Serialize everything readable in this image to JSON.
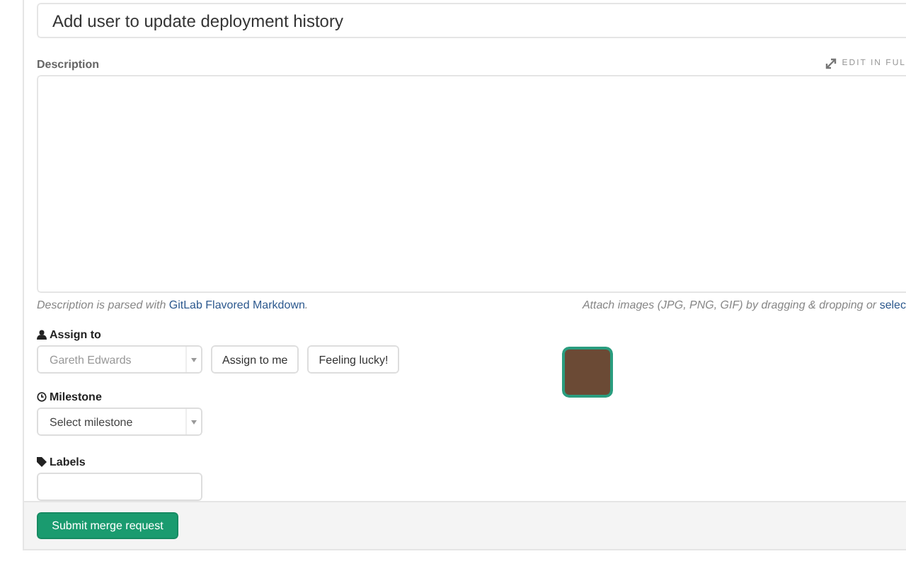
{
  "title_field": {
    "value": "Add user to update deployment history"
  },
  "description": {
    "label": "Description",
    "edit_link": "EDIT IN FUL",
    "hint_prefix": "Description is parsed with ",
    "hint_link": "GitLab Flavored Markdown",
    "hint_suffix": ".",
    "attach_text": "Attach images (JPG, PNG, GIF) by dragging & dropping or ",
    "attach_link": "selec"
  },
  "assign": {
    "label": "Assign to",
    "value": "Gareth Edwards",
    "buttons": [
      "Assign to me",
      "Feeling lucky!"
    ]
  },
  "milestone": {
    "label": "Milestone",
    "placeholder": "Select milestone"
  },
  "labels": {
    "label": "Labels"
  },
  "submit": "Submit merge request"
}
